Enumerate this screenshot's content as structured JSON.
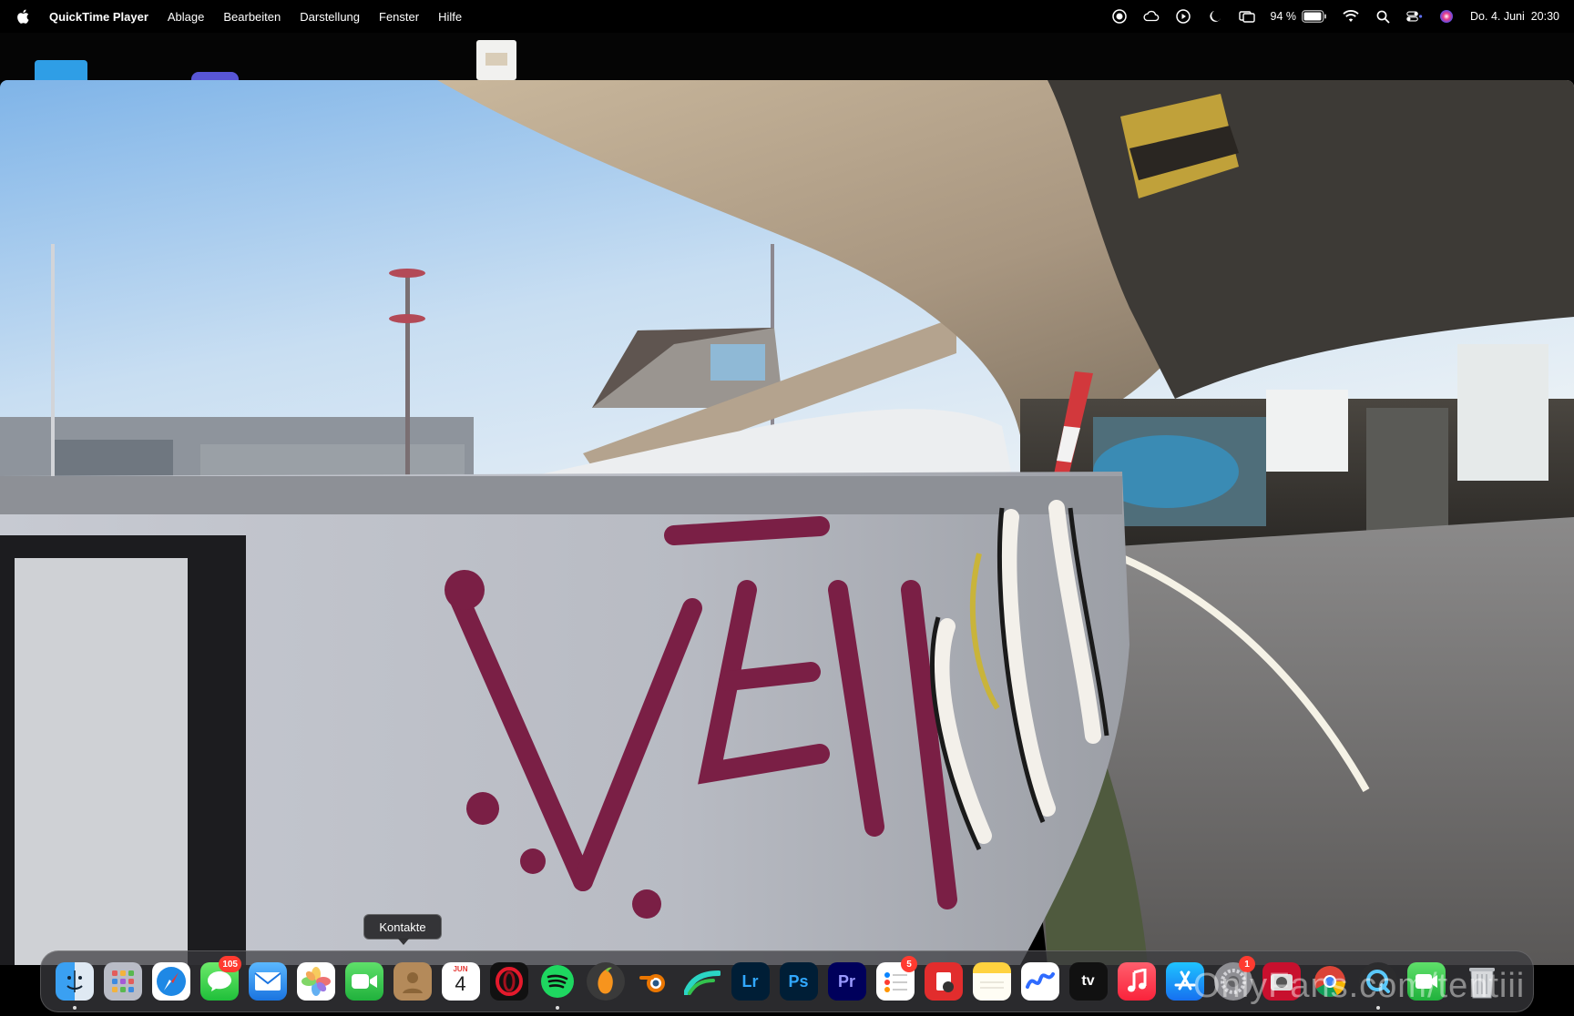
{
  "menubar": {
    "app_name": "QuickTime Player",
    "menus": [
      "Ablage",
      "Bearbeiten",
      "Darstellung",
      "Fenster",
      "Hilfe"
    ],
    "battery_percent": "94 %",
    "datetime": "Do. 4. Juni  20:30",
    "status_icons": [
      "screen-record-icon",
      "cloud-icon",
      "play-circle-icon",
      "moon-icon",
      "screen-mirroring-icon",
      "battery-icon",
      "wifi-icon",
      "search-icon",
      "control-center-icon",
      "siri-icon"
    ]
  },
  "tooltip": {
    "text": "Kontakte"
  },
  "dock": {
    "items": [
      {
        "name": "finder",
        "icon": "finder-icon",
        "running": true
      },
      {
        "name": "launchpad",
        "icon": "launchpad-icon"
      },
      {
        "name": "safari",
        "icon": "safari-icon"
      },
      {
        "name": "messages",
        "icon": "messages-icon",
        "badge": "105"
      },
      {
        "name": "mail",
        "icon": "mail-icon"
      },
      {
        "name": "photos",
        "icon": "photos-icon"
      },
      {
        "name": "facetime",
        "icon": "facetime-icon"
      },
      {
        "name": "contacts",
        "icon": "contacts-icon"
      },
      {
        "name": "calendar",
        "icon": "calendar-icon",
        "month": "JUN",
        "day": "4"
      },
      {
        "name": "opera",
        "icon": "opera-icon"
      },
      {
        "name": "spotify",
        "icon": "spotify-icon",
        "running": true
      },
      {
        "name": "fl-studio",
        "icon": "fl-studio-icon"
      },
      {
        "name": "blender",
        "icon": "blender-icon"
      },
      {
        "name": "final-cut",
        "icon": "final-cut-icon"
      },
      {
        "name": "lightroom",
        "icon": "lightroom-icon",
        "label": "Lr"
      },
      {
        "name": "photoshop",
        "icon": "photoshop-icon",
        "label": "Ps"
      },
      {
        "name": "premiere",
        "icon": "premiere-icon",
        "label": "Pr"
      },
      {
        "name": "reminders",
        "icon": "reminders-icon",
        "badge": "5"
      },
      {
        "name": "pdf-app",
        "icon": "pdf-app-icon"
      },
      {
        "name": "notes",
        "icon": "notes-icon"
      },
      {
        "name": "freeform",
        "icon": "freeform-icon"
      },
      {
        "name": "apple-tv",
        "icon": "apple-tv-icon",
        "label": "tv"
      },
      {
        "name": "music",
        "icon": "music-icon"
      },
      {
        "name": "app-store",
        "icon": "app-store-icon"
      },
      {
        "name": "system-settings",
        "icon": "system-settings-icon",
        "badge": "1"
      },
      {
        "name": "photo-booth",
        "icon": "photo-booth-icon"
      },
      {
        "name": "chrome",
        "icon": "chrome-icon"
      },
      {
        "name": "quicktime",
        "icon": "quicktime-icon"
      },
      {
        "name": "facetime-2",
        "icon": "green-app-icon"
      },
      {
        "name": "trash",
        "icon": "trash-icon"
      }
    ]
  },
  "watermark": "OnlyFans.com/tentiii",
  "colors": {
    "menubar_bg": "#000000",
    "dock_bg": "#3a3a3e",
    "badge": "#ff3b30"
  }
}
